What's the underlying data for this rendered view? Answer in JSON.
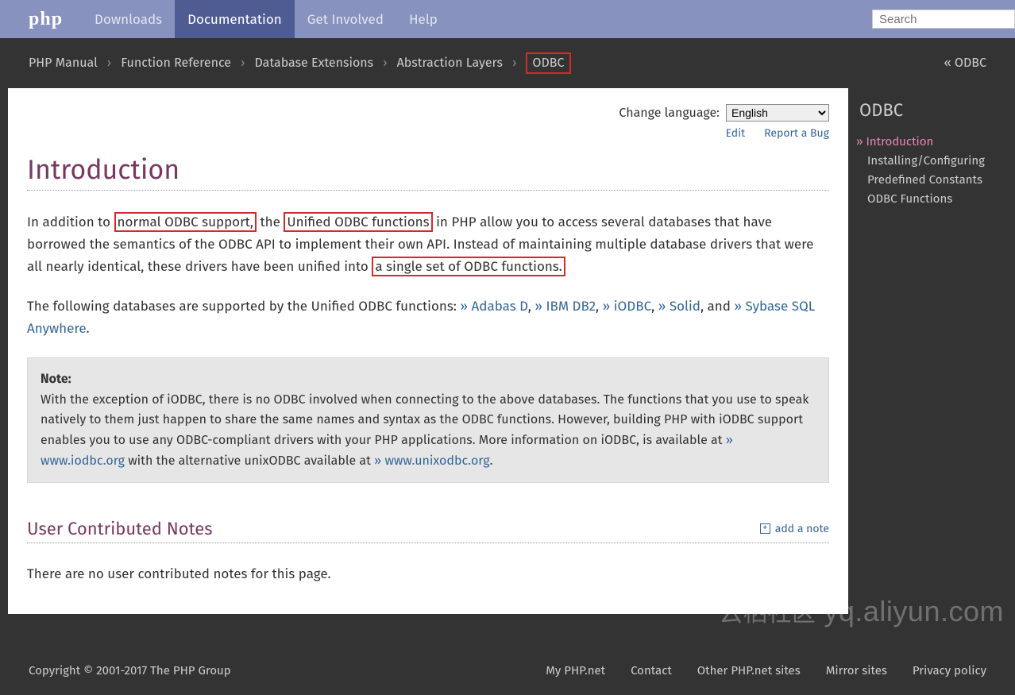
{
  "nav": {
    "logo": "php",
    "items": [
      "Downloads",
      "Documentation",
      "Get Involved",
      "Help"
    ],
    "active_index": 1,
    "search_placeholder": "Search"
  },
  "breadcrumb": {
    "items": [
      "PHP Manual",
      "Function Reference",
      "Database Extensions",
      "Abstraction Layers",
      "ODBC"
    ],
    "highlighted_index": 4,
    "prev_label": "« ODBC"
  },
  "lang": {
    "label": "Change language:",
    "selected": "English"
  },
  "toplinks": {
    "edit": "Edit",
    "bug": "Report a Bug"
  },
  "page": {
    "title": "Introduction",
    "para1_pre": "In addition to ",
    "para1_hl1": "normal ODBC support,",
    "para1_mid1": " the ",
    "para1_hl2": "Unified ODBC functions",
    "para1_mid2": " in PHP allow you to access several databases that have borrowed the semantics of the ODBC API to implement their own API. Instead of maintaining multiple database drivers that were all nearly identical, these drivers have been unified into ",
    "para1_hl3": "a single set of ODBC functions.",
    "para2_pre": "The following databases are supported by the Unified ODBC functions: ",
    "db_links": [
      "» Adabas D",
      "» IBM DB2",
      "» iODBC",
      "» Solid"
    ],
    "para2_and": ", and ",
    "db_link_last": "» Sybase SQL Anywhere",
    "para2_end": "."
  },
  "note": {
    "label": "Note",
    "text_pre": "With the exception of iODBC, there is no ODBC involved when connecting to the above databases. The functions that you use to speak natively to them just happen to share the same names and syntax as the ODBC functions. However, building PHP with iODBC support enables you to use any ODBC-compliant drivers with your PHP applications. More information on iODBC, is available at ",
    "link1": "» www.iodbc.org",
    "text_mid": " with the alternative unixODBC available at ",
    "link2": "» www.unixodbc.org",
    "text_end": "."
  },
  "ucn": {
    "heading": "User Contributed Notes",
    "add": "add a note",
    "empty": "There are no user contributed notes for this page."
  },
  "sidebar": {
    "title": "ODBC",
    "items": [
      "Introduction",
      "Installing/Configuring",
      "Predefined Constants",
      "ODBC Functions"
    ],
    "current_index": 0
  },
  "footer": {
    "copy": "Copyright © 2001-2017 The PHP Group",
    "links": [
      "My PHP.net",
      "Contact",
      "Other PHP.net sites",
      "Mirror sites",
      "Privacy policy"
    ]
  },
  "watermark": {
    "cn": "云栖社区",
    "en": "yq.aliyun.com"
  }
}
